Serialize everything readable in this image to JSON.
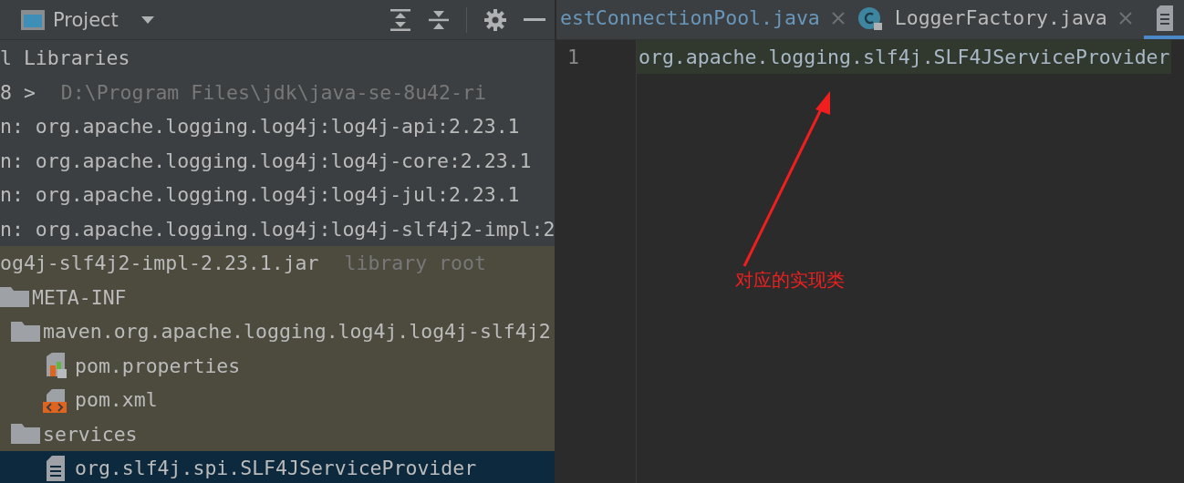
{
  "project_panel": {
    "title": "Project",
    "tree": [
      {
        "kind": "entry",
        "text": "l Libraries",
        "selected": false
      },
      {
        "kind": "entry",
        "text": "8 >",
        "path": "D:\\Program Files\\jdk\\java-se-8u42-ri",
        "selected": false
      },
      {
        "kind": "entry",
        "text": "n: org.apache.logging.log4j:log4j-api:2.23.1",
        "selected": false
      },
      {
        "kind": "entry",
        "text": "n: org.apache.logging.log4j:log4j-core:2.23.1",
        "selected": false
      },
      {
        "kind": "entry",
        "text": "n: org.apache.logging.log4j:log4j-jul:2.23.1",
        "selected": false
      },
      {
        "kind": "entry",
        "text": "n: org.apache.logging.log4j:log4j-slf4j2-impl:2",
        "selected": false
      },
      {
        "kind": "library-root",
        "text": "og4j-slf4j2-impl-2.23.1.jar",
        "path": "library root",
        "selected": false,
        "children": [
          {
            "kind": "folder",
            "text": "META-INF",
            "selected": false,
            "children": [
              {
                "kind": "folder",
                "text": "maven.org.apache.logging.log4j.log4j-slf4j2",
                "selected": false,
                "children": [
                  {
                    "kind": "properties-file",
                    "text": "pom.properties",
                    "selected": false
                  },
                  {
                    "kind": "xml-file",
                    "text": "pom.xml",
                    "selected": false
                  }
                ]
              },
              {
                "kind": "folder",
                "text": "services",
                "selected": false,
                "children": [
                  {
                    "kind": "text-file",
                    "text": "org.slf4j.spi.SLF4JServiceProvider",
                    "selected": true
                  }
                ]
              }
            ]
          }
        ]
      }
    ]
  },
  "editor": {
    "tabs": [
      {
        "kind": "modified",
        "label": "estConnectionPool.java",
        "selected": false
      },
      {
        "kind": "class",
        "label": "LoggerFactory.java",
        "selected": false
      },
      {
        "kind": "text-file",
        "selected": true
      }
    ],
    "lines": [
      {
        "number": "1",
        "text": "org.apache.logging.slf4j.SLF4JServiceProvider"
      }
    ],
    "annotation": "对应的实现类"
  }
}
